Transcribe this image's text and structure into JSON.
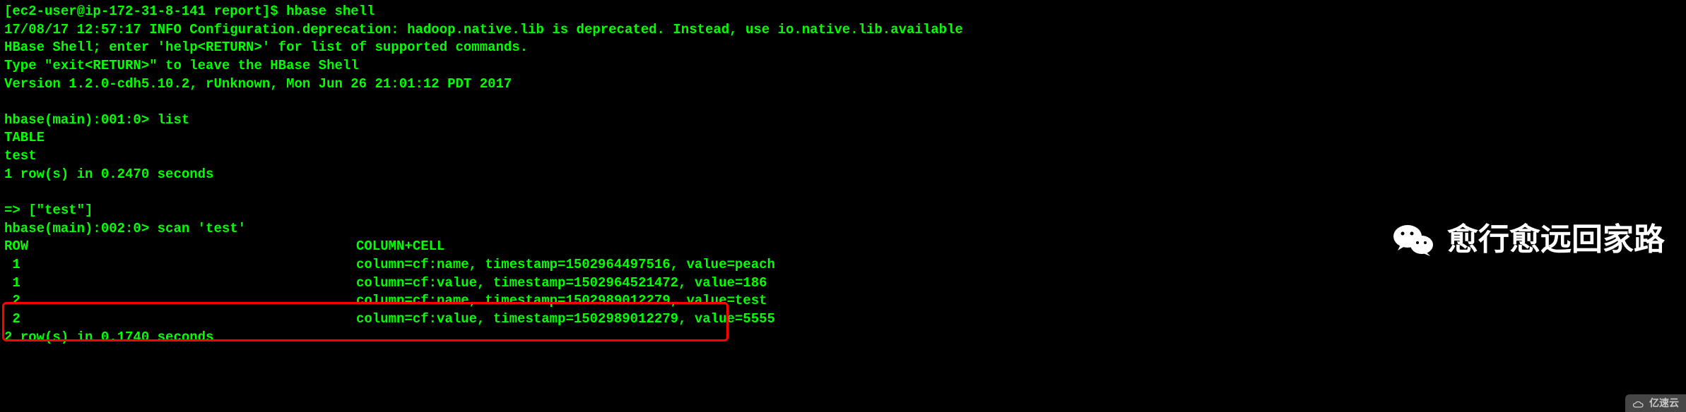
{
  "prompt1": "[ec2-user@ip-172-31-8-141 report]$ ",
  "cmd1": "hbase shell",
  "banner_deprecation": "17/08/17 12:57:17 INFO Configuration.deprecation: hadoop.native.lib is deprecated. Instead, use io.native.lib.available",
  "banner_help": "HBase Shell; enter 'help<RETURN>' for list of supported commands.",
  "banner_exit": "Type \"exit<RETURN>\" to leave the HBase Shell",
  "banner_version": "Version 1.2.0-cdh5.10.2, rUnknown, Mon Jun 26 21:01:12 PDT 2017",
  "prompt2": "hbase(main):001:0> ",
  "cmd2": "list",
  "list_header": "TABLE",
  "list_row1": "test",
  "list_summary": "1 row(s) in 0.2470 seconds",
  "list_return": "=> [\"test\"]",
  "prompt3": "hbase(main):002:0> ",
  "cmd3": "scan 'test'",
  "scan_header_row": "ROW",
  "scan_header_col": "COLUMN+CELL",
  "scan_rows": [
    {
      "key": " 1",
      "cell": "column=cf:name, timestamp=1502964497516, value=peach"
    },
    {
      "key": " 1",
      "cell": "column=cf:value, timestamp=1502964521472, value=186"
    },
    {
      "key": " 2",
      "cell": "column=cf:name, timestamp=1502989012279, value=test"
    },
    {
      "key": " 2",
      "cell": "column=cf:value, timestamp=1502989012279, value=5555"
    }
  ],
  "scan_summary": "2 row(s) in 0.1740 seconds",
  "watermark_text": "愈行愈远回家路",
  "corner_badge": "亿速云"
}
